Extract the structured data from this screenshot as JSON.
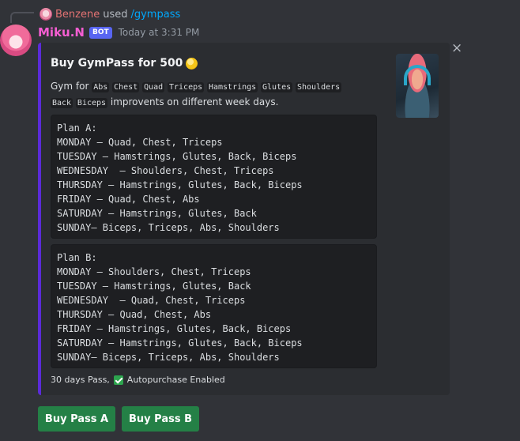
{
  "reply": {
    "user": "Benzene",
    "text": "used",
    "command": "/gympass"
  },
  "author": {
    "name": "Miku.N",
    "tag": "BOT",
    "timestamp": "Today at 3:31 PM"
  },
  "embed": {
    "title": "Buy GymPass for 500",
    "desc_prefix": "Gym for",
    "muscles": [
      "Abs",
      "Chest",
      "Quad",
      "Triceps",
      "Hamstrings",
      "Glutes",
      "Shoulders",
      "Back",
      "Biceps"
    ],
    "desc_suffix": "improvents on different week days.",
    "plan_a": "Plan A:\nMONDAY – Quad, Chest, Triceps\nTUESDAY – Hamstrings, Glutes, Back, Biceps\nWEDNESDAY  – Shoulders, Chest, Triceps\nTHURSDAY – Hamstrings, Glutes, Back, Biceps\nFRIDAY – Quad, Chest, Abs\nSATURDAY – Hamstrings, Glutes, Back\nSUNDAY– Biceps, Triceps, Abs, Shoulders",
    "plan_b": "Plan B:\nMONDAY – Shoulders, Chest, Triceps\nTUESDAY – Hamstrings, Glutes, Back\nWEDNESDAY  – Quad, Chest, Triceps\nTHURSDAY – Quad, Chest, Abs\nFRIDAY – Hamstrings, Glutes, Back, Biceps\nSATURDAY – Hamstrings, Glutes, Back, Biceps\nSUNDAY– Biceps, Triceps, Abs, Shoulders",
    "footer_text": "30 days Pass,",
    "footer_status": "Autopurchase Enabled",
    "accent_color": "#5b2bd9",
    "title_icon": "coin-icon"
  },
  "buttons": {
    "pass_a": "Buy Pass A",
    "pass_b": "Buy Pass B",
    "color": "#248046"
  },
  "icons": {
    "close": "×"
  }
}
